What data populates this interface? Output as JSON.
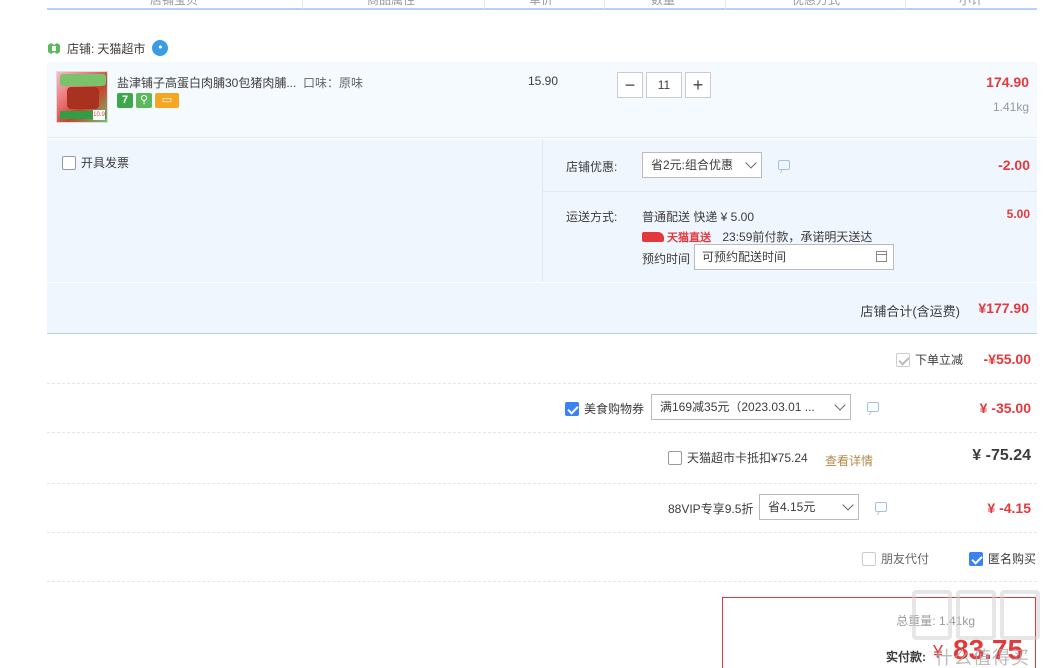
{
  "header": {
    "columns": [
      "店铺宝贝",
      "商品属性",
      "单价",
      "数量",
      "优惠方式",
      "小计"
    ]
  },
  "shop": {
    "label": "店铺:",
    "name": "天猫超市"
  },
  "item": {
    "title": "盐津铺子高蛋白肉脯30包猪肉脯...",
    "sku": "口味：原味",
    "unit_price": "15.90",
    "quantity": "11",
    "minus": "−",
    "plus": "+",
    "subtotal": "174.90",
    "weight": "1.41kg",
    "badge_seven": "7"
  },
  "invoice": {
    "label": "开具发票",
    "checked": false
  },
  "store_discount": {
    "label": "店铺优惠:",
    "selected": "省2元:组合优惠",
    "amount": "-2.00"
  },
  "shipping": {
    "label": "运送方式:",
    "method": "普通配送 快递 ¥ 5.00",
    "direct": "天猫直送",
    "promise": "23:59前付款，承诺明天送达",
    "appointment_label": "预约时间",
    "appointment_value": "可预约配送时间",
    "amount": "5.00"
  },
  "shop_total": {
    "label": "店铺合计(含运费)",
    "value": "¥177.90"
  },
  "order_discount": {
    "label": "下单立减",
    "amount": "-¥55.00"
  },
  "food_coupon": {
    "label": "美食购物券",
    "selected": "满169减35元（2023.03.01 ...",
    "amount": "¥ -35.00",
    "checked": true
  },
  "tmall_card": {
    "label": "天猫超市卡抵扣¥75.24",
    "link": "查看详情",
    "amount": "¥ -75.24",
    "checked": false
  },
  "vip": {
    "label": "88VIP专享9.5折",
    "selected": "省4.15元",
    "amount": "¥ -4.15"
  },
  "options": {
    "friend_pay": "朋友代付",
    "anonymous": "匿名购买",
    "anonymous_checked": true
  },
  "payment": {
    "weight": "总重量: 1.41kg",
    "label": "实付款:",
    "currency": "¥",
    "value": "83.75"
  },
  "watermark": {
    "text": "什么值得买"
  },
  "colors": {
    "accent_red": "#e4393c",
    "light_blue_bg": "#f0f6fe",
    "border_blue": "#b2d1ff",
    "checkbox_blue": "#3b82f6"
  }
}
